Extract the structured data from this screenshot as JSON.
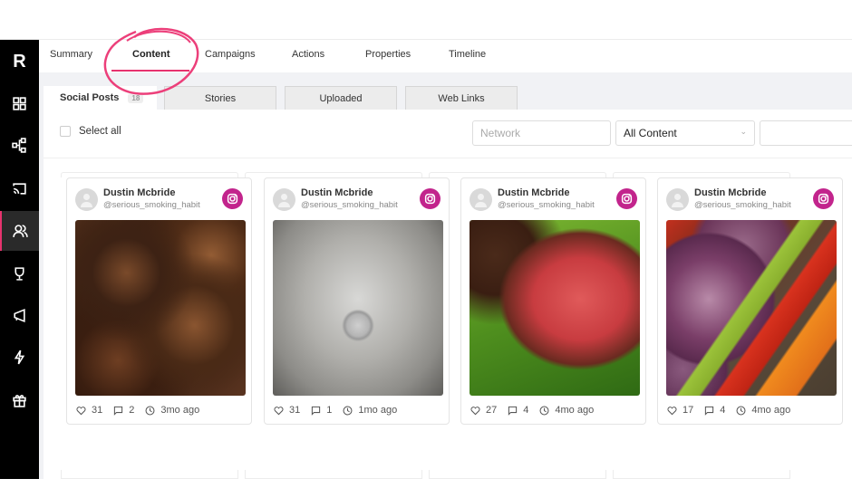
{
  "sidebar": {
    "logo": "R",
    "items": [
      {
        "name": "dashboard",
        "icon": "grid-icon"
      },
      {
        "name": "hierarchy",
        "icon": "hierarchy-icon"
      },
      {
        "name": "cast",
        "icon": "cast-icon"
      },
      {
        "name": "people",
        "icon": "users-icon",
        "active": true
      },
      {
        "name": "rewards",
        "icon": "trophy-icon"
      },
      {
        "name": "campaigns",
        "icon": "megaphone-icon"
      },
      {
        "name": "actions",
        "icon": "lightning-icon"
      },
      {
        "name": "gifts",
        "icon": "gift-icon"
      }
    ]
  },
  "topnav": {
    "tabs": [
      "Summary",
      "Content",
      "Campaigns",
      "Actions",
      "Properties",
      "Timeline"
    ],
    "active": "Content"
  },
  "subtabs": {
    "social_posts": "Social Posts",
    "social_posts_count": "18",
    "stories": "Stories",
    "uploaded": "Uploaded",
    "web_links": "Web Links"
  },
  "toolbar": {
    "select_all": "Select all",
    "network_placeholder": "Network",
    "content_filter": "All Content",
    "extra_filter": ""
  },
  "colors": {
    "accent": "#e6336e",
    "instagram": "#c2248c",
    "sidebar": "#000000"
  },
  "posts": [
    {
      "user": "Dustin Mcbride",
      "handle": "@serious_smoking_habit",
      "network": "instagram",
      "likes": "31",
      "comments": "2",
      "time": "3mo ago",
      "image": "grilled chicken thighs"
    },
    {
      "user": "Dustin Mcbride",
      "handle": "@serious_smoking_habit",
      "network": "instagram",
      "likes": "31",
      "comments": "1",
      "time": "1mo ago",
      "image": "stainless steel pan lid with engraved text"
    },
    {
      "user": "Dustin Mcbride",
      "handle": "@serious_smoking_habit",
      "network": "instagram",
      "likes": "27",
      "comments": "4",
      "time": "4mo ago",
      "image": "sliced medium-rare steak on green leaf"
    },
    {
      "user": "Dustin Mcbride",
      "handle": "@serious_smoking_habit",
      "network": "instagram",
      "likes": "17",
      "comments": "4",
      "time": "4mo ago",
      "image": "grilled onions and peppers"
    }
  ]
}
